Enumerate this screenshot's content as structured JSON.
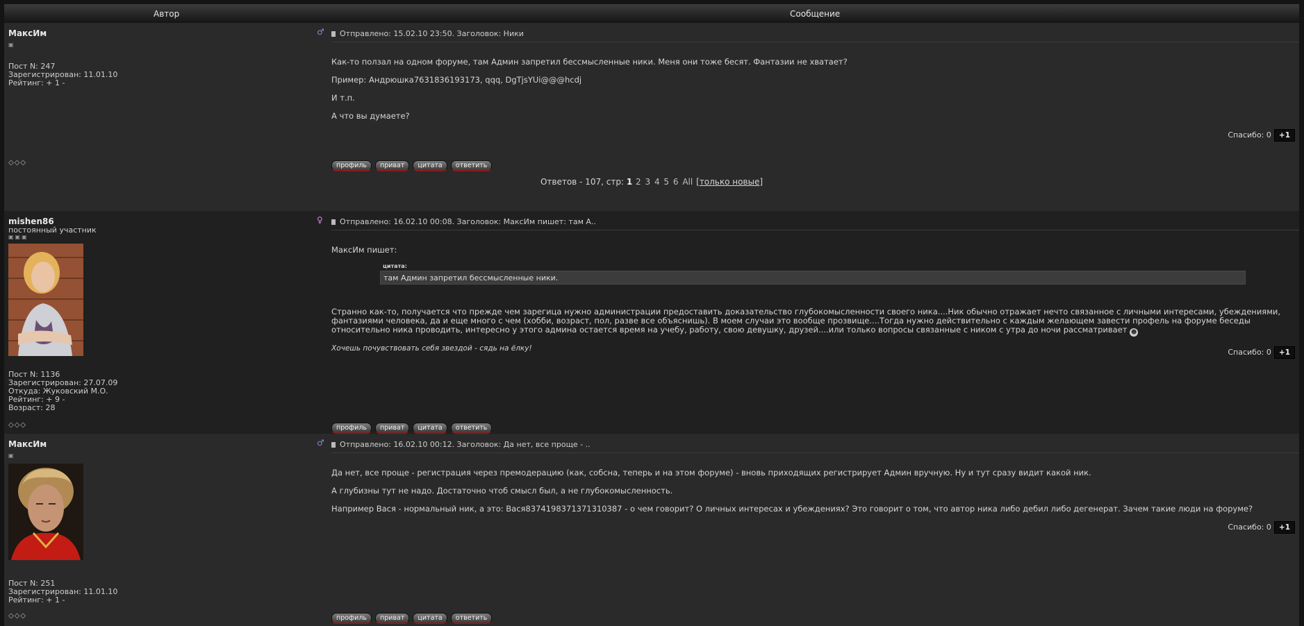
{
  "header": {
    "author_col": "Автор",
    "message_col": "Сообщение"
  },
  "buttons": {
    "profile": "профиль",
    "private": "приват",
    "quote": "цитата",
    "reply": "ответить"
  },
  "thanks_plus": "+1",
  "posts": [
    {
      "author": "МаксИм",
      "rank": "",
      "stars": "▣",
      "info": [
        "Пост N: 247",
        "Зарегистрирован: 11.01.10",
        "Рейтинг: + 1 -"
      ],
      "gender": "male",
      "gender_icon": "♂",
      "header": "Отправлено: 15.02.10 23:50. Заголовок: Ники",
      "paragraphs": [
        "Как-то ползал на одном форуме, там Админ запретил бессмысленные ники. Меня они тоже бесят. Фантазии не хватает?",
        "Пример: Андрюшка7631836193173, qqq, DgTjsYUi@@@hcdj",
        "И т.п.",
        "А что вы думаете?"
      ],
      "thanks": "Спасибо: 0",
      "status_icons": "◇◇◇"
    },
    {
      "author": "mishen86",
      "rank": "постоянный участник",
      "stars": "▣▣▣",
      "info": [
        "Пост N: 1136",
        "Зарегистрирован: 27.07.09",
        "Откуда: Жуковский М.О.",
        "Рейтинг: + 9 -",
        "Возраст: 28"
      ],
      "gender": "female",
      "gender_icon": "♀",
      "header": "Отправлено: 16.02.10 00:08. Заголовок: МаксИм пишет: там А..",
      "quote_intro": "МаксИм пишет:",
      "quote_label": "цитата:",
      "quote_text": "там Админ запретил бессмысленные ники.",
      "body": "Странно как-то, получается что прежде чем зарегица нужно администрации предоставить доказательство глубокомысленности своего ника....Ник обычно отражает нечто связанное с личными интересами, убеждениями, фантазиями человека, да и еще много с чем (хобби, возраст, пол, разве все объяснишь). В моем случаи это вообще прозвище....Тогда нужно действительно с каждым желающем завести профель на форуме беседы относительно ника проводить, интересно у этого админа остается время на учебу, работу, свою девушку, друзей....или только вопросы связанные с ником с утра до ночи рассматривает",
      "signature": "Хочешь почувствовать себя звездой - сядь на ёлку!",
      "thanks": "Спасибо: 0",
      "status_icons": "◇◇◇"
    },
    {
      "author": "МаксИм",
      "rank": "",
      "stars": "▣",
      "info": [
        "Пост N: 251",
        "Зарегистрирован: 11.01.10",
        "Рейтинг: + 1 -"
      ],
      "gender": "male",
      "gender_icon": "♂",
      "header": "Отправлено: 16.02.10 00:12. Заголовок: Да нет, все проще - ..",
      "paragraphs": [
        "Да нет, все проще - регистрация через премодерацию (как, собсна, теперь и на этом форуме) - вновь приходящих регистрирует Админ вручную. Ну и тут сразу видит какой ник.",
        "А глубизны тут не надо. Достаточно чтоб смысл был, а не глубокомысленность.",
        "Например Вася - нормальный ник, а это: Вася8374198371371310387 - о чем говорит? О личных интересах и убеждениях? Это говорит о том, что автор ника либо дебил либо дегенерат. Зачем такие люди на форуме?"
      ],
      "thanks": "Спасибо: 0",
      "status_icons": "◇◇◇"
    }
  ],
  "pager": {
    "prefix": "Ответов - 107, стр:",
    "current": "1",
    "pages": [
      "2",
      "3",
      "4",
      "5",
      "6",
      "All"
    ],
    "only_new": "только новые"
  },
  "colors": {
    "male": "#8a8ad8",
    "female": "#d68ad6",
    "button_border": "#8a1b1b"
  }
}
